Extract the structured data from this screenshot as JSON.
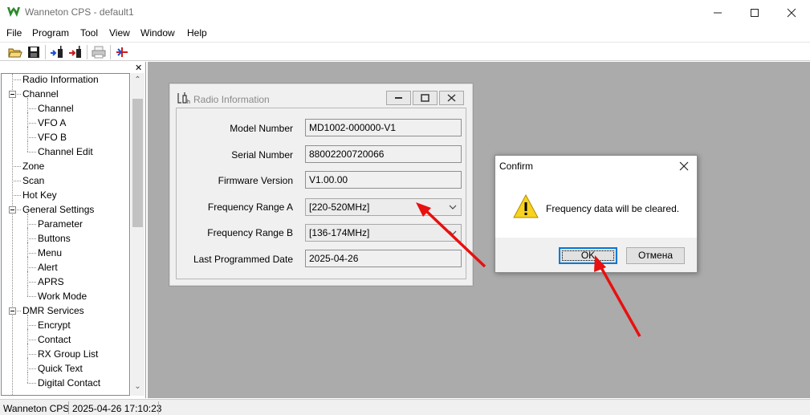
{
  "window": {
    "title": "Wanneton CPS - default1",
    "icons": [
      "app-logo-icon",
      "minimize-icon",
      "maximize-icon",
      "close-icon"
    ]
  },
  "menu": {
    "items": [
      "File",
      "Program",
      "Tool",
      "View",
      "Window",
      "Help"
    ]
  },
  "toolbar": {
    "icons": [
      "open-folder-icon",
      "save-icon",
      "read-from-radio-icon",
      "write-to-radio-icon",
      "print-icon",
      "radio-connect-icon"
    ]
  },
  "tree": {
    "items": [
      {
        "label": "Radio Information",
        "level": 0
      },
      {
        "label": "Channel",
        "level": 0,
        "expanded": true
      },
      {
        "label": "Channel",
        "level": 1
      },
      {
        "label": "VFO A",
        "level": 1
      },
      {
        "label": "VFO B",
        "level": 1
      },
      {
        "label": "Channel Edit",
        "level": 1
      },
      {
        "label": "Zone",
        "level": 0
      },
      {
        "label": "Scan",
        "level": 0
      },
      {
        "label": "Hot Key",
        "level": 0
      },
      {
        "label": "General Settings",
        "level": 0,
        "expanded": true
      },
      {
        "label": "Parameter",
        "level": 1
      },
      {
        "label": "Buttons",
        "level": 1
      },
      {
        "label": "Menu",
        "level": 1
      },
      {
        "label": "Alert",
        "level": 1
      },
      {
        "label": "APRS",
        "level": 1
      },
      {
        "label": "Work Mode",
        "level": 1
      },
      {
        "label": "DMR Services",
        "level": 0,
        "expanded": true
      },
      {
        "label": "Encrypt",
        "level": 1
      },
      {
        "label": "Contact",
        "level": 1
      },
      {
        "label": "RX Group List",
        "level": 1
      },
      {
        "label": "Quick Text",
        "level": 1
      },
      {
        "label": "Digital Contact",
        "level": 1
      }
    ]
  },
  "radio_info": {
    "title": "Radio Information",
    "fields": [
      {
        "label": "Model Number",
        "value": "MD1002-000000-V1",
        "type": "text"
      },
      {
        "label": "Serial Number",
        "value": "88002200720066",
        "type": "text"
      },
      {
        "label": "Firmware Version",
        "value": "V1.00.00",
        "type": "text"
      },
      {
        "label": "Frequency Range A",
        "value": "[220-520MHz]",
        "type": "combo"
      },
      {
        "label": "Frequency Range B",
        "value": "[136-174MHz]",
        "type": "combo"
      },
      {
        "label": "Last Programmed Date",
        "value": "2025-04-26",
        "type": "text"
      }
    ]
  },
  "confirm": {
    "title": "Confirm",
    "message": "Frequency data will be cleared.",
    "ok_label": "OK",
    "cancel_label": "Отмена",
    "icon": "warning-icon"
  },
  "status": {
    "app": "Wanneton CPS",
    "datetime": "2025-04-26 17:10:23"
  },
  "colors": {
    "workspace": "#ababab",
    "annotation_arrow": "#e81010",
    "focus_border": "#0078d7"
  }
}
